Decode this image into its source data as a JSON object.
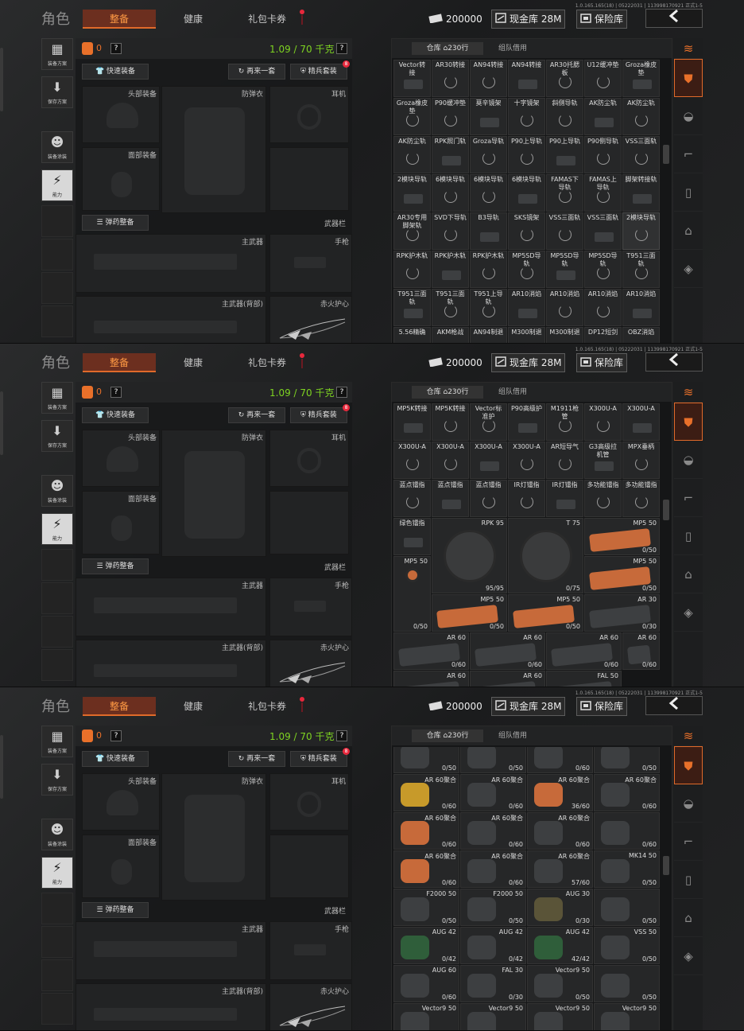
{
  "header": {
    "version": "1.0.165.165(18) | 05222031 | 113998170921 正式1-5",
    "title": "角色",
    "tabs": [
      "整备",
      "健康",
      "礼包卡券"
    ],
    "money": "200000",
    "cash_vault": "现金库 28M",
    "safe": "保险库",
    "back_icon": "chevron-left-icon"
  },
  "sidebar": [
    "装备方案",
    "保存方案",
    "装备涂装",
    "能力"
  ],
  "equip": {
    "bag_count": "0",
    "help": "?",
    "weight": "1.09 / 70 千克",
    "quick_equip": "快速装备",
    "again": "再来一套",
    "elite": "精兵套装",
    "elite_badge": "8",
    "slots": {
      "head": "头部装备",
      "armor": "防弹衣",
      "ear": "耳机",
      "face": "面部装备",
      "ammo": "弹药整备",
      "weapon_bar": "武器栏",
      "primary": "主武器",
      "pistol": "手枪",
      "primary_back": "主武器(背部)",
      "amulet": "赤火护心"
    }
  },
  "inventory": {
    "tab_warehouse": "仓库",
    "tab_count": "230行",
    "tab_team": "组队借用"
  },
  "grid1": [
    [
      "Vector转接",
      "AR30转接",
      "AN94转接",
      "AN94转接",
      "AR30托腮板",
      "U12缓冲垫",
      "Groza橡皮垫"
    ],
    [
      "Groza橡皮垫",
      "P90缓冲垫",
      "莫辛镜架",
      "十字镜架",
      "斜侧导轨",
      "AK防尘轨",
      "AK防尘轨"
    ],
    [
      "AK防尘轨",
      "RPK照门轨",
      "Groza导轨",
      "P90上导轨",
      "P90上导轨",
      "P90侧导轨",
      "VSS三面轨"
    ],
    [
      "2模块导轨",
      "6模块导轨",
      "6模块导轨",
      "6模块导轨",
      "FAMAS下导轨",
      "FAMAS上导轨",
      "脚架转接轨"
    ],
    [
      "AR30专用脚架轨",
      "SVD下导轨",
      "B3导轨",
      "SKS镜架",
      "VSS三面轨",
      "VSS三面轨",
      "2模块导轨"
    ],
    [
      "RPK护木轨",
      "RPK护木轨",
      "RPK护木轨",
      "MP5SD导轨",
      "MP5SD导轨",
      "MP5SD导轨",
      "T951三面轨"
    ],
    [
      "T951三面轨",
      "T951三面轨",
      "T951上导轨",
      "AR10消焰",
      "AR10消焰",
      "AR10消焰",
      "AR10消焰"
    ],
    [
      "5.56精确",
      "AKM枪战",
      "AN94制退",
      "M300制退",
      "M300制退",
      "DP12短剑",
      "OBZ消焰"
    ]
  ],
  "grid2": {
    "small": [
      [
        "MP5K转接",
        "MP5K转接",
        "Vector标准护",
        "P90高级护",
        "M1911枪管",
        "X300U-A",
        "X300U-A"
      ],
      [
        "X300U-A",
        "X300U-A",
        "X300U-A",
        "X300U-A",
        "AR短导气",
        "G3高级拉机管",
        "MPX垂柄"
      ],
      [
        "蓝点镭指",
        "蓝点镭指",
        "蓝点镭指",
        "IR灯镭指",
        "IR灯镭指",
        "多功能镭指",
        "多功能镭指"
      ],
      [
        "绿色镭指"
      ]
    ],
    "mags": [
      {
        "name": "RPK 95",
        "count": "95/95"
      },
      {
        "name": "T 75",
        "count": "0/75"
      },
      {
        "name": "MP5 50",
        "count": "0/50"
      },
      {
        "name": "MP5 50",
        "count": "0/50"
      },
      {
        "name": "MP5 50",
        "count": "0/50"
      },
      {
        "name": "MP5 50",
        "count": "0/50"
      },
      {
        "name": "MP5 50",
        "count": "0/50"
      },
      {
        "name": "AR 30",
        "count": "0/30"
      },
      {
        "name": "AR 60",
        "count": "0/60"
      },
      {
        "name": "AR 60",
        "count": "0/60"
      },
      {
        "name": "AR 60",
        "count": "0/60"
      },
      {
        "name": "AR 60",
        "count": "0/60"
      },
      {
        "name": "AR 60",
        "count": ""
      },
      {
        "name": "AR 60",
        "count": ""
      },
      {
        "name": "FAL 50",
        "count": ""
      }
    ]
  },
  "grid3": [
    {
      "name": "",
      "count": "0/50"
    },
    {
      "name": "",
      "count": "0/50"
    },
    {
      "name": "",
      "count": "0/60"
    },
    {
      "name": "",
      "count": "0/50"
    },
    {
      "name": "AR 60聚合",
      "count": "0/60"
    },
    {
      "name": "AR 60聚合",
      "count": "0/60"
    },
    {
      "name": "AR 60聚合",
      "count": "36/60"
    },
    {
      "name": "AR 60聚合",
      "count": "0/60"
    },
    {
      "name": "AR 60聚合",
      "count": "0/60"
    },
    {
      "name": "AR 60聚合",
      "count": "0/60"
    },
    {
      "name": "AR 60聚合",
      "count": "0/60"
    },
    {
      "name": "",
      "count": "0/60"
    },
    {
      "name": "AR 60聚合",
      "count": "0/60"
    },
    {
      "name": "AR 60聚合",
      "count": "0/60"
    },
    {
      "name": "AR 60聚合",
      "count": "57/60"
    },
    {
      "name": "MK14 50",
      "count": "0/50"
    },
    {
      "name": "F2000 50",
      "count": "0/50"
    },
    {
      "name": "F2000 50",
      "count": "0/50"
    },
    {
      "name": "AUG 30",
      "count": "0/30"
    },
    {
      "name": "",
      "count": "0/50"
    },
    {
      "name": "AUG 42",
      "count": "0/42"
    },
    {
      "name": "AUG 42",
      "count": "0/42"
    },
    {
      "name": "AUG 42",
      "count": "42/42"
    },
    {
      "name": "VSS 50",
      "count": "0/50"
    },
    {
      "name": "AUG 60",
      "count": "0/60"
    },
    {
      "name": "FAL 30",
      "count": "0/30"
    },
    {
      "name": "Vector9 50",
      "count": "0/50"
    },
    {
      "name": "",
      "count": "0/50"
    },
    {
      "name": "Vector9 50",
      "count": ""
    },
    {
      "name": "Vector9 50",
      "count": ""
    },
    {
      "name": "Vector9 50",
      "count": ""
    },
    {
      "name": "Vector9 50",
      "count": ""
    }
  ],
  "colors": {
    "accent": "#e8702a",
    "weight": "#7ed321",
    "alert": "#e8283c"
  }
}
